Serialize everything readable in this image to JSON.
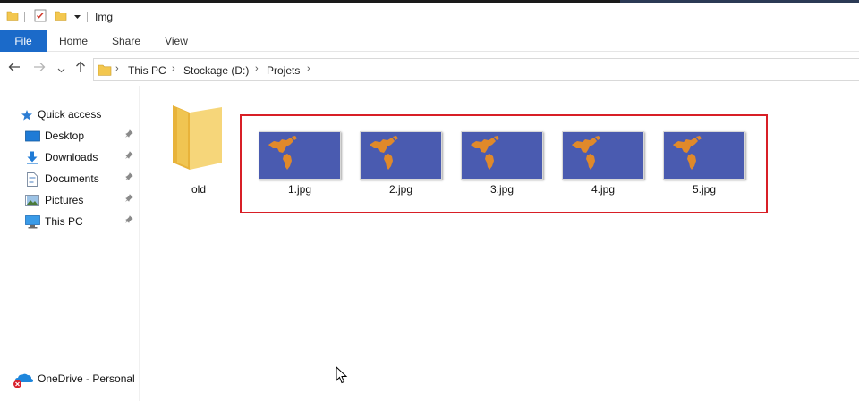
{
  "window": {
    "title": "Img"
  },
  "ribbon": {
    "tabs": [
      {
        "label": "File",
        "active": true
      },
      {
        "label": "Home"
      },
      {
        "label": "Share"
      },
      {
        "label": "View"
      }
    ]
  },
  "address": {
    "breadcrumbs": [
      "This PC",
      "Stockage (D:)",
      "Projets"
    ]
  },
  "sidebar": {
    "items": [
      {
        "label": "Quick access",
        "icon": "star-icon"
      },
      {
        "label": "Desktop",
        "icon": "desktop-icon",
        "pinned": true
      },
      {
        "label": "Downloads",
        "icon": "download-icon",
        "pinned": true
      },
      {
        "label": "Documents",
        "icon": "documents-icon",
        "pinned": true
      },
      {
        "label": "Pictures",
        "icon": "pictures-icon",
        "pinned": true
      },
      {
        "label": "This PC",
        "icon": "computer-icon",
        "pinned": true
      },
      {
        "label": "OneDrive - Personal",
        "icon": "onedrive-icon"
      }
    ]
  },
  "content": {
    "folder": {
      "name": "old"
    },
    "files": [
      {
        "name": "1.jpg"
      },
      {
        "name": "2.jpg"
      },
      {
        "name": "3.jpg"
      },
      {
        "name": "4.jpg"
      },
      {
        "name": "5.jpg"
      }
    ]
  },
  "colors": {
    "file_tab": "#1b6ac9",
    "highlight_border": "#d81f26",
    "thumb_background": "#4a5bb0",
    "map_land": "#e0892a",
    "folder": "#f3c74f"
  }
}
